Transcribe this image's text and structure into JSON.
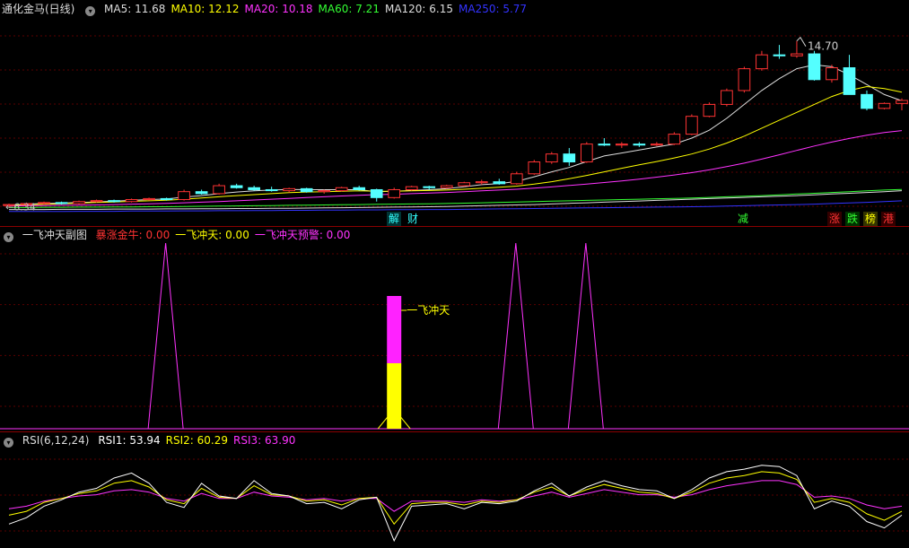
{
  "main_panel": {
    "title": "通化金马(日线)",
    "indicators": [
      {
        "label": "MA5: ",
        "value": "11.68",
        "color": "#dddddd"
      },
      {
        "label": "MA10: ",
        "value": "12.12",
        "color": "#ffff00"
      },
      {
        "label": "MA20: ",
        "value": "10.18",
        "color": "#ff33ff"
      },
      {
        "label": "MA60: ",
        "value": "7.21",
        "color": "#33ff33"
      },
      {
        "label": "MA120: ",
        "value": "6.15",
        "color": "#dddddd"
      },
      {
        "label": "MA250: ",
        "value": "5.77",
        "color": "#3333ff"
      }
    ],
    "high_label": "14.70",
    "low_label": "6.34",
    "badges": [
      {
        "text": "解",
        "color": "#33ffff",
        "bg": "#003333"
      },
      {
        "text": "财",
        "color": "#33ffff",
        "bg": "#000"
      },
      {
        "text": "减",
        "color": "#33ff33",
        "bg": "#000"
      },
      {
        "text": "涨",
        "color": "#ff3333",
        "bg": "#330000"
      },
      {
        "text": "跌",
        "color": "#33ff33",
        "bg": "#003300"
      },
      {
        "text": "榜",
        "color": "#ffff00",
        "bg": "#333300"
      },
      {
        "text": "港",
        "color": "#ff3333",
        "bg": "#330000"
      }
    ]
  },
  "sub_panel": {
    "title": "一飞冲天副图",
    "indicators": [
      {
        "label": "暴涨金牛: ",
        "value": "0.00",
        "color": "#ff3333"
      },
      {
        "label": "一飞冲天: ",
        "value": "0.00",
        "color": "#ffff00"
      },
      {
        "label": "一飞冲天预警: ",
        "value": "0.00",
        "color": "#ff33ff"
      }
    ],
    "annotation": "一飞冲天"
  },
  "rsi_panel": {
    "title": "RSI(6,12,24)",
    "indicators": [
      {
        "label": "RSI1: ",
        "value": "53.94",
        "color": "#ffffff"
      },
      {
        "label": "RSI2: ",
        "value": "60.29",
        "color": "#ffff00"
      },
      {
        "label": "RSI3: ",
        "value": "63.90",
        "color": "#ff33ff"
      }
    ]
  },
  "chart_data": [
    {
      "type": "candlestick",
      "ylim": [
        6.0,
        15.5
      ],
      "ohlc": [
        [
          6.4,
          6.5,
          6.34,
          6.45
        ],
        [
          6.45,
          6.55,
          6.4,
          6.5
        ],
        [
          6.5,
          6.6,
          6.45,
          6.55
        ],
        [
          6.55,
          6.6,
          6.45,
          6.5
        ],
        [
          6.5,
          6.65,
          6.45,
          6.6
        ],
        [
          6.6,
          6.7,
          6.55,
          6.65
        ],
        [
          6.65,
          6.7,
          6.55,
          6.6
        ],
        [
          6.6,
          6.75,
          6.55,
          6.7
        ],
        [
          6.7,
          6.8,
          6.65,
          6.75
        ],
        [
          6.75,
          6.8,
          6.65,
          6.7
        ],
        [
          6.7,
          7.2,
          6.65,
          7.1
        ],
        [
          7.1,
          7.2,
          6.95,
          7.0
        ],
        [
          7.0,
          7.5,
          6.95,
          7.4
        ],
        [
          7.4,
          7.5,
          7.25,
          7.3
        ],
        [
          7.3,
          7.4,
          7.15,
          7.2
        ],
        [
          7.2,
          7.35,
          7.1,
          7.15
        ],
        [
          7.15,
          7.3,
          7.05,
          7.25
        ],
        [
          7.25,
          7.3,
          7.05,
          7.1
        ],
        [
          7.1,
          7.2,
          7.0,
          7.15
        ],
        [
          7.15,
          7.35,
          7.1,
          7.3
        ],
        [
          7.3,
          7.4,
          7.15,
          7.2
        ],
        [
          7.2,
          7.25,
          6.6,
          6.8
        ],
        [
          6.8,
          7.3,
          6.75,
          7.2
        ],
        [
          7.2,
          7.4,
          7.15,
          7.35
        ],
        [
          7.35,
          7.4,
          7.2,
          7.3
        ],
        [
          7.3,
          7.45,
          7.25,
          7.4
        ],
        [
          7.4,
          7.6,
          7.35,
          7.55
        ],
        [
          7.55,
          7.7,
          7.45,
          7.6
        ],
        [
          7.6,
          7.75,
          7.45,
          7.5
        ],
        [
          7.5,
          8.1,
          7.45,
          8.0
        ],
        [
          8.0,
          8.7,
          7.95,
          8.6
        ],
        [
          8.6,
          9.1,
          8.5,
          9.0
        ],
        [
          9.0,
          9.3,
          8.4,
          8.6
        ],
        [
          8.6,
          9.6,
          8.55,
          9.5
        ],
        [
          9.5,
          9.8,
          9.4,
          9.45
        ],
        [
          9.45,
          9.6,
          9.3,
          9.5
        ],
        [
          9.5,
          9.6,
          9.35,
          9.45
        ],
        [
          9.45,
          9.6,
          9.4,
          9.5
        ],
        [
          9.5,
          10.1,
          9.45,
          10.0
        ],
        [
          10.0,
          11.0,
          9.95,
          10.9
        ],
        [
          10.9,
          11.6,
          10.85,
          11.5
        ],
        [
          11.5,
          12.3,
          11.4,
          12.2
        ],
        [
          12.2,
          13.4,
          12.1,
          13.3
        ],
        [
          13.3,
          14.2,
          13.2,
          14.0
        ],
        [
          14.0,
          14.5,
          13.8,
          13.95
        ],
        [
          13.95,
          14.7,
          13.85,
          14.05
        ],
        [
          14.05,
          14.2,
          12.7,
          12.75
        ],
        [
          12.75,
          13.5,
          12.6,
          13.35
        ],
        [
          13.35,
          14.0,
          12.9,
          12.0
        ],
        [
          12.0,
          12.2,
          11.2,
          11.3
        ],
        [
          11.3,
          11.6,
          11.25,
          11.55
        ],
        [
          11.55,
          11.8,
          11.2,
          11.7
        ]
      ],
      "series": [
        {
          "name": "MA5",
          "color": "#dddddd",
          "values": [
            6.42,
            6.47,
            6.5,
            6.52,
            6.55,
            6.58,
            6.62,
            6.66,
            6.7,
            6.73,
            6.83,
            6.9,
            7.0,
            7.08,
            7.14,
            7.18,
            7.21,
            7.2,
            7.2,
            7.2,
            7.2,
            7.1,
            7.12,
            7.16,
            7.2,
            7.25,
            7.35,
            7.45,
            7.5,
            7.62,
            7.85,
            8.1,
            8.32,
            8.62,
            8.9,
            9.05,
            9.2,
            9.35,
            9.5,
            9.8,
            10.2,
            10.8,
            11.5,
            12.2,
            12.8,
            13.3,
            13.5,
            13.4,
            13.0,
            12.5,
            12.0,
            11.68
          ]
        },
        {
          "name": "MA10",
          "color": "#ffff00",
          "values": [
            6.4,
            6.43,
            6.46,
            6.49,
            6.52,
            6.55,
            6.58,
            6.61,
            6.64,
            6.67,
            6.72,
            6.78,
            6.84,
            6.9,
            6.95,
            7.0,
            7.05,
            7.08,
            7.1,
            7.12,
            7.14,
            7.12,
            7.12,
            7.14,
            7.16,
            7.18,
            7.22,
            7.27,
            7.32,
            7.38,
            7.48,
            7.6,
            7.75,
            7.92,
            8.1,
            8.28,
            8.45,
            8.62,
            8.8,
            9.0,
            9.25,
            9.55,
            9.9,
            10.3,
            10.7,
            11.1,
            11.5,
            11.9,
            12.2,
            12.4,
            12.3,
            12.12
          ]
        },
        {
          "name": "MA20",
          "color": "#ff33ff",
          "values": [
            6.38,
            6.39,
            6.4,
            6.41,
            6.42,
            6.43,
            6.45,
            6.47,
            6.49,
            6.51,
            6.54,
            6.57,
            6.6,
            6.64,
            6.68,
            6.72,
            6.76,
            6.8,
            6.84,
            6.88,
            6.92,
            6.95,
            6.97,
            7.0,
            7.03,
            7.06,
            7.1,
            7.14,
            7.18,
            7.22,
            7.28,
            7.34,
            7.41,
            7.48,
            7.56,
            7.64,
            7.73,
            7.83,
            7.94,
            8.06,
            8.2,
            8.36,
            8.54,
            8.74,
            8.96,
            9.18,
            9.4,
            9.6,
            9.78,
            9.95,
            10.08,
            10.18
          ]
        },
        {
          "name": "MA60",
          "color": "#33ff33",
          "values": [
            6.3,
            6.3,
            6.31,
            6.31,
            6.32,
            6.32,
            6.33,
            6.33,
            6.34,
            6.34,
            6.35,
            6.36,
            6.37,
            6.38,
            6.39,
            6.4,
            6.41,
            6.42,
            6.43,
            6.44,
            6.45,
            6.46,
            6.47,
            6.48,
            6.49,
            6.5,
            6.52,
            6.54,
            6.56,
            6.58,
            6.6,
            6.62,
            6.64,
            6.66,
            6.68,
            6.7,
            6.72,
            6.74,
            6.76,
            6.78,
            6.81,
            6.84,
            6.87,
            6.9,
            6.94,
            6.98,
            7.02,
            7.06,
            7.1,
            7.14,
            7.18,
            7.21
          ]
        },
        {
          "name": "MA120",
          "color": "#dddddd",
          "values": [
            6.2,
            6.2,
            6.2,
            6.21,
            6.21,
            6.21,
            6.22,
            6.22,
            6.22,
            6.23,
            6.23,
            6.24,
            6.24,
            6.25,
            6.25,
            6.26,
            6.26,
            6.27,
            6.28,
            6.29,
            6.3,
            6.31,
            6.32,
            6.33,
            6.34,
            6.35,
            6.37,
            6.39,
            6.41,
            6.43,
            6.45,
            6.48,
            6.51,
            6.54,
            6.57,
            6.6,
            6.63,
            6.66,
            6.69,
            6.72,
            6.75,
            6.78,
            6.81,
            6.84,
            6.87,
            6.9,
            6.94,
            6.98,
            7.02,
            7.06,
            7.1,
            7.15
          ]
        },
        {
          "name": "MA250",
          "color": "#3333ff",
          "values": [
            6.1,
            6.1,
            6.1,
            6.1,
            6.11,
            6.11,
            6.11,
            6.12,
            6.12,
            6.12,
            6.13,
            6.13,
            6.14,
            6.14,
            6.15,
            6.15,
            6.16,
            6.16,
            6.17,
            6.17,
            6.18,
            6.18,
            6.19,
            6.19,
            6.2,
            6.2,
            6.21,
            6.22,
            6.23,
            6.24,
            6.25,
            6.26,
            6.27,
            6.28,
            6.29,
            6.3,
            6.31,
            6.32,
            6.33,
            6.34,
            6.35,
            6.37,
            6.39,
            6.41,
            6.43,
            6.45,
            6.47,
            6.5,
            6.53,
            6.56,
            6.6,
            6.64
          ]
        }
      ]
    },
    {
      "type": "line",
      "series": [
        {
          "name": "一飞冲天预警",
          "color": "#ff33ff",
          "values": [
            0,
            0,
            0,
            0,
            0,
            0,
            0,
            0,
            0,
            1,
            0,
            0,
            0,
            0,
            0,
            0,
            0,
            0,
            0,
            0,
            0,
            0,
            0,
            0,
            0,
            0,
            0,
            0,
            0,
            0,
            0,
            0,
            0,
            0,
            0,
            0,
            0,
            0,
            0,
            0,
            0,
            0,
            0,
            0,
            0,
            0,
            0,
            0,
            0,
            0,
            0,
            0
          ]
        },
        {
          "name": "一飞冲天",
          "color": "#ffff00",
          "values": [
            0,
            0,
            0,
            0,
            0,
            0,
            0,
            0,
            0,
            0,
            0,
            0,
            0,
            0,
            0,
            0,
            0,
            0,
            0,
            0,
            0,
            0,
            0.7,
            0,
            0,
            0,
            0,
            0,
            0,
            0,
            0,
            0,
            0,
            0,
            0,
            0,
            0,
            0,
            0,
            0,
            0,
            0,
            0,
            0,
            0,
            0,
            0,
            0,
            0,
            0,
            0,
            0
          ]
        }
      ],
      "ylim": [
        0,
        1
      ]
    },
    {
      "type": "line",
      "ylim": [
        10,
        90
      ],
      "series": [
        {
          "name": "RSI1",
          "color": "#ffffff",
          "values": [
            28,
            33,
            42,
            47,
            53,
            56,
            64,
            68,
            60,
            45,
            41,
            60,
            50,
            48,
            62,
            52,
            50,
            44,
            45,
            40,
            47,
            49,
            15,
            42,
            43,
            44,
            40,
            45,
            44,
            46,
            54,
            60,
            50,
            57,
            62,
            58,
            55,
            54,
            48,
            55,
            64,
            69,
            71,
            74,
            73,
            66,
            40,
            46,
            42,
            30,
            25,
            35
          ]
        },
        {
          "name": "RSI2",
          "color": "#ffff00",
          "values": [
            35,
            38,
            45,
            48,
            52,
            54,
            60,
            62,
            57,
            47,
            44,
            56,
            49,
            48,
            58,
            51,
            50,
            46,
            47,
            43,
            48,
            49,
            28,
            44,
            45,
            45,
            43,
            46,
            45,
            47,
            53,
            57,
            50,
            55,
            59,
            56,
            53,
            52,
            48,
            53,
            60,
            64,
            66,
            69,
            68,
            63,
            45,
            48,
            45,
            36,
            31,
            38
          ]
        },
        {
          "name": "RSI3",
          "color": "#ff33ff",
          "values": [
            40,
            42,
            46,
            48,
            50,
            51,
            54,
            55,
            53,
            48,
            46,
            52,
            48,
            48,
            53,
            50,
            49,
            47,
            48,
            46,
            48,
            48,
            38,
            46,
            46,
            46,
            45,
            47,
            46,
            47,
            50,
            53,
            49,
            52,
            55,
            53,
            51,
            51,
            49,
            51,
            55,
            58,
            60,
            62,
            62,
            59,
            49,
            50,
            48,
            43,
            40,
            42
          ]
        }
      ]
    }
  ]
}
